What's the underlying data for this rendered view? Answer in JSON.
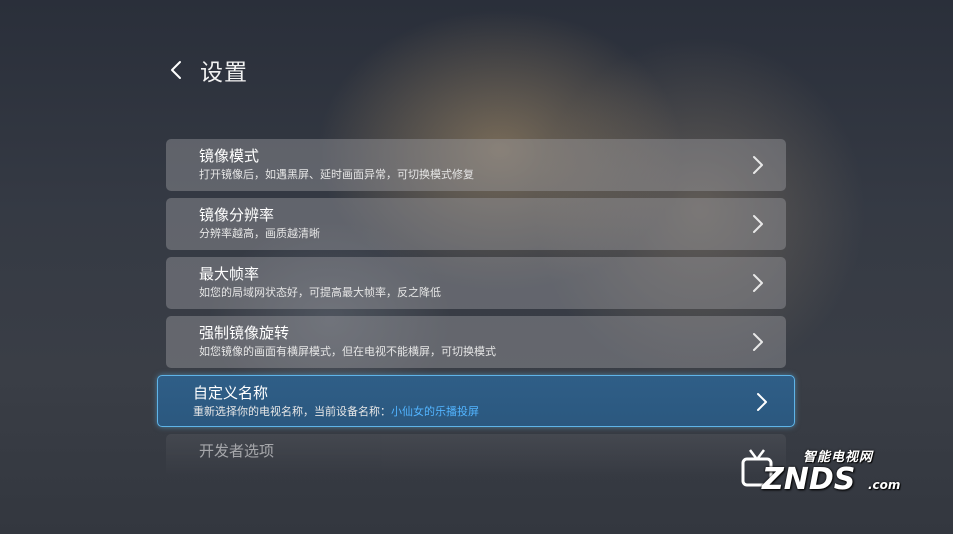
{
  "header": {
    "back_icon": "chevron-left-icon",
    "title": "设置"
  },
  "settings": {
    "items": [
      {
        "title": "镜像模式",
        "subtitle": "打开镜像后，如遇黑屏、延时画面异常，可切换模式修复"
      },
      {
        "title": "镜像分辨率",
        "subtitle": "分辨率越高，画质越清晰"
      },
      {
        "title": "最大帧率",
        "subtitle": "如您的局域网状态好，可提高最大帧率，反之降低"
      },
      {
        "title": "强制镜像旋转",
        "subtitle": "如您镜像的画面有横屏模式，但在电视不能横屏，可切换模式"
      },
      {
        "title": "自定义名称",
        "subtitle_prefix": "重新选择你的电视名称，当前设备名称：",
        "device_name": "小仙女的乐播投屏",
        "focused": true
      },
      {
        "title": "开发者选项"
      }
    ],
    "chevron_icon": "chevron-right-icon"
  },
  "watermark": {
    "cn": "智能电视网",
    "logo": "ZNDS",
    "suffix": ".com"
  },
  "colors": {
    "focus_border": "#5fb4e8",
    "focus_bg": "#2f5e87",
    "highlight_text": "#52b4ff"
  }
}
